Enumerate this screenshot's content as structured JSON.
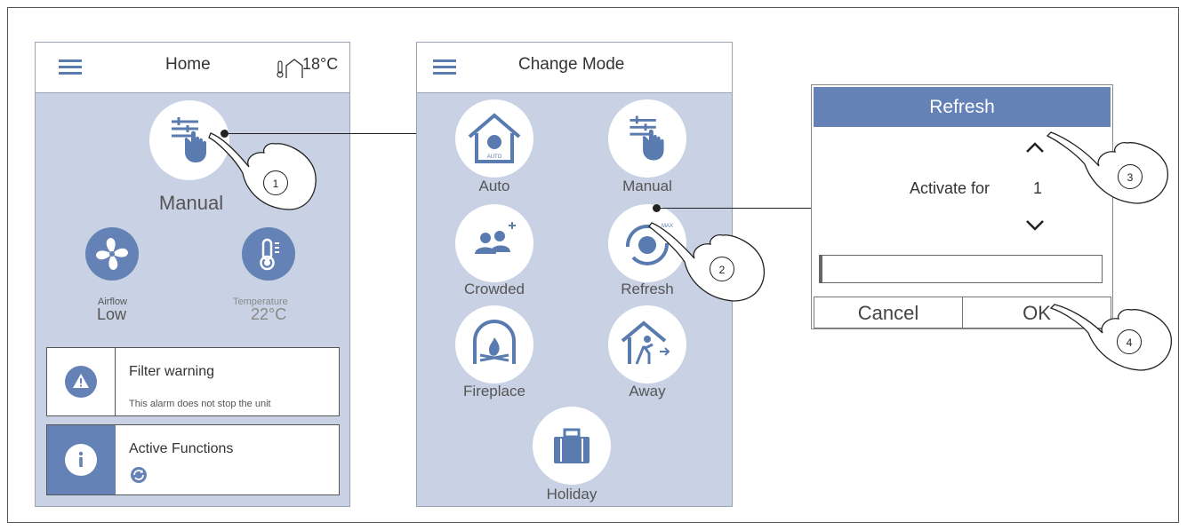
{
  "home": {
    "title": "Home",
    "temperature": "18°C",
    "mode_label": "Manual",
    "airflow_label": "Airflow",
    "airflow_value": "Low",
    "temp_label": "Temperature",
    "temp_value": "22°C",
    "filter_title": "Filter warning",
    "filter_sub": "This alarm does not stop the unit",
    "active_title": "Active Functions"
  },
  "change_mode": {
    "title": "Change Mode",
    "modes": [
      "Auto",
      "Manual",
      "Crowded",
      "Refresh",
      "Fireplace",
      "Away",
      "Holiday"
    ],
    "auto_badge": "AUTO",
    "max_badge": "MAX"
  },
  "dialog": {
    "title": "Refresh",
    "activate_label": "Activate for",
    "activate_value": "1",
    "cancel": "Cancel",
    "ok": "OK"
  },
  "callouts": [
    "1",
    "2",
    "3",
    "4"
  ],
  "colors": {
    "accent": "#6482b5",
    "panel": "#c9d2e4",
    "icon_blue": "#5a7bb0"
  }
}
